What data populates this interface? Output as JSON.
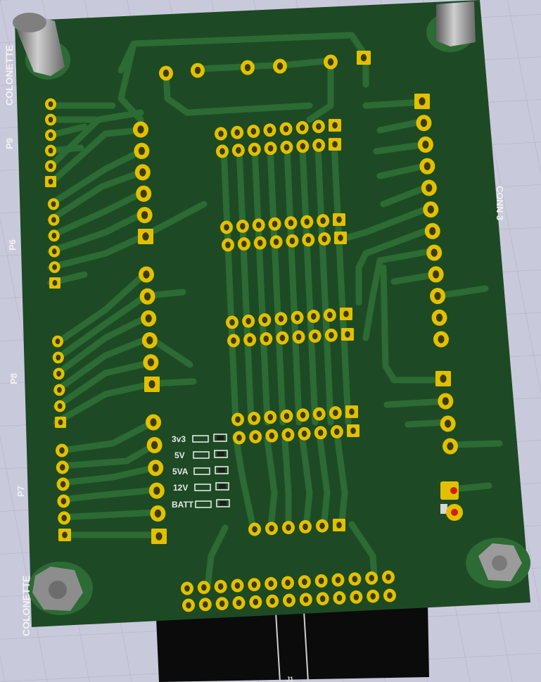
{
  "board": {
    "colors": {
      "background": "#c9c9dc",
      "grid": "#b3b3c8",
      "substrate": "#1d4a24",
      "trace": "#2c6b34",
      "pad": "#e2c000",
      "drill": "#3b3b00",
      "silkscreen": "#ffffff",
      "led_red": "#d61d00",
      "standoff": "#9a9a9a",
      "connector": "#0b0b0b"
    },
    "side_labels": {
      "top_left": "COLONETTE",
      "bottom_left": "COLONETTE",
      "p9": "P9",
      "p8": "P8",
      "p7": "P7",
      "p6": "P6",
      "right": "CONN 3"
    },
    "leds": [
      {
        "label": "3v3"
      },
      {
        "label": "5V"
      },
      {
        "label": "5VA"
      },
      {
        "label": "12V"
      },
      {
        "label": "BATT"
      }
    ],
    "bottom_connector_label": "J1"
  }
}
